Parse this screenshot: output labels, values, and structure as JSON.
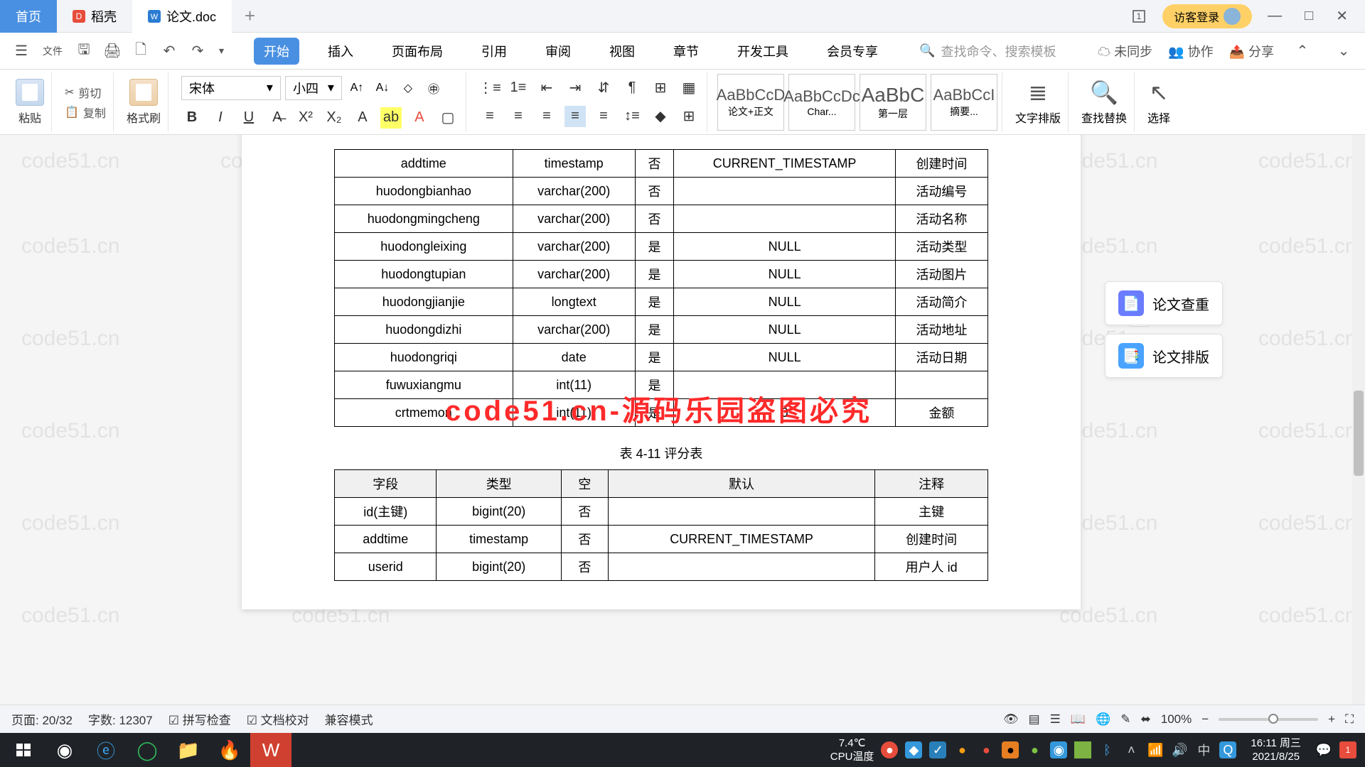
{
  "titlebar": {
    "tabs": [
      {
        "label": "首页",
        "type": "home"
      },
      {
        "label": "稻壳",
        "icon": "#e74c3c"
      },
      {
        "label": "论文.doc",
        "icon": "#2b7cd3",
        "active": true
      }
    ],
    "login": "访客登录"
  },
  "menubar": {
    "file": "文件",
    "tabs": [
      "开始",
      "插入",
      "页面布局",
      "引用",
      "审阅",
      "视图",
      "章节",
      "开发工具",
      "会员专享"
    ],
    "active": 0,
    "search_placeholder": "查找命令、搜索模板",
    "right": [
      "未同步",
      "协作",
      "分享"
    ]
  },
  "ribbon": {
    "paste": "粘贴",
    "cut": "剪切",
    "copy": "复制",
    "format_painter": "格式刷",
    "font": "宋体",
    "size": "小四",
    "styles": [
      {
        "preview": "AaBbCcD",
        "name": "论文+正文"
      },
      {
        "preview": "AaBbCcDc",
        "name": "Char..."
      },
      {
        "preview": "AaBbC",
        "name": "第一层"
      },
      {
        "preview": "AaBbCcI",
        "name": "摘要..."
      }
    ],
    "text_layout": "文字排版",
    "find_replace": "查找替换",
    "select": "选择"
  },
  "table1": {
    "rows": [
      {
        "c1": "addtime",
        "c2": "timestamp",
        "c3": "否",
        "c4": "CURRENT_TIMESTAMP",
        "c5": "创建时间"
      },
      {
        "c1": "huodongbianhao",
        "c2": "varchar(200)",
        "c3": "否",
        "c4": "",
        "c5": "活动编号"
      },
      {
        "c1": "huodongmingcheng",
        "c2": "varchar(200)",
        "c3": "否",
        "c4": "",
        "c5": "活动名称"
      },
      {
        "c1": "huodongleixing",
        "c2": "varchar(200)",
        "c3": "是",
        "c4": "NULL",
        "c5": "活动类型"
      },
      {
        "c1": "huodongtupian",
        "c2": "varchar(200)",
        "c3": "是",
        "c4": "NULL",
        "c5": "活动图片"
      },
      {
        "c1": "huodongjianjie",
        "c2": "longtext",
        "c3": "是",
        "c4": "NULL",
        "c5": "活动简介"
      },
      {
        "c1": "huodongdizhi",
        "c2": "varchar(200)",
        "c3": "是",
        "c4": "NULL",
        "c5": "活动地址"
      },
      {
        "c1": "huodongriqi",
        "c2": "date",
        "c3": "是",
        "c4": "NULL",
        "c5": "活动日期"
      },
      {
        "c1": "fuwuxiangmu",
        "c2": "int(11)",
        "c3": "是",
        "c4": "",
        "c5": ""
      },
      {
        "c1": "crtmemon",
        "c2": "int(11)",
        "c3": "是",
        "c4": "0",
        "c5": "金额"
      }
    ]
  },
  "caption2": "表 4-11 评分表",
  "table2": {
    "headers": [
      "字段",
      "类型",
      "空",
      "默认",
      "注释"
    ],
    "rows": [
      {
        "c1": "id(主键)",
        "c2": "bigint(20)",
        "c3": "否",
        "c4": "",
        "c5": "主键"
      },
      {
        "c1": "addtime",
        "c2": "timestamp",
        "c3": "否",
        "c4": "CURRENT_TIMESTAMP",
        "c5": "创建时间"
      },
      {
        "c1": "userid",
        "c2": "bigint(20)",
        "c3": "否",
        "c4": "",
        "c5": "用户人 id"
      }
    ]
  },
  "overlay": "code51.cn-源码乐园盗图必究",
  "watermark_text": "code51.cn",
  "side_panel": {
    "item1": "论文查重",
    "item2": "论文排版"
  },
  "statusbar": {
    "page": "页面: 20/32",
    "words": "字数: 12307",
    "spell": "拼写检查",
    "proof": "文档校对",
    "compat": "兼容模式",
    "zoom": "100%"
  },
  "taskbar": {
    "cpu": "7.4℃",
    "cpu_label": "CPU温度",
    "time": "16:11 周三",
    "date": "2021/8/25"
  }
}
